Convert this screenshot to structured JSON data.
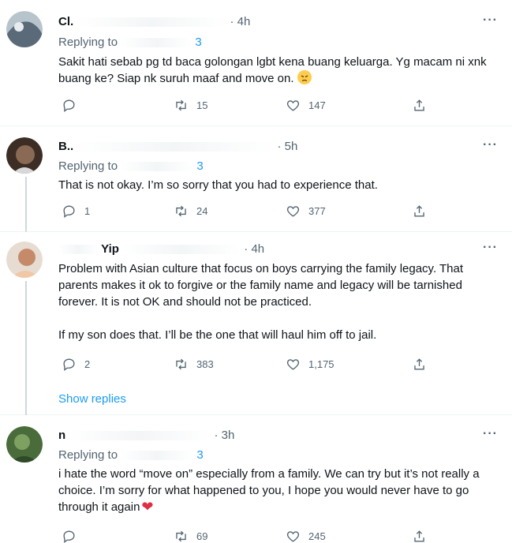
{
  "colors": {
    "accent": "#1d9bf0",
    "secondary_text": "#536471",
    "primary_text": "#0f1419",
    "heart": "#dd2e44"
  },
  "tweets": [
    {
      "name": "Cl.",
      "time": "· 4h",
      "replying_prefix": "Replying to",
      "replying_suffix": "3",
      "text": [
        "Sakit hati sebab pg td baca golongan lgbt kena buang keluarga. Yg macam ni xnk buang ke? Siap nk suruh maaf and move on."
      ],
      "emoji": "angry-face",
      "replies": "",
      "retweets": "15",
      "likes": "147"
    },
    {
      "name": "B..",
      "time": "· 5h",
      "replying_prefix": "Replying to",
      "replying_suffix": "3",
      "text": [
        "That is not okay. I’m so sorry that you had to experience that."
      ],
      "replies": "1",
      "retweets": "24",
      "likes": "377"
    },
    {
      "name": "Yip",
      "time": "· 4h",
      "text": [
        "Problem with Asian culture that focus on boys carrying the family legacy. That parents makes it ok to forgive or the family name and legacy will be tarnished forever. It is not OK and should not be practiced.",
        "If my son does that. I’ll be the one that will haul him off to jail."
      ],
      "replies": "2",
      "retweets": "383",
      "likes": "1,175",
      "show_replies": "Show replies"
    },
    {
      "name": "n",
      "time": "· 3h",
      "replying_prefix": "Replying to",
      "replying_suffix": "3",
      "text": [
        "i hate the word “move on” especially from a family. We can try but it’s not really a choice. I’m sorry for what happened to you, I hope you would never have to go through it again"
      ],
      "emoji": "red-heart",
      "replies": "",
      "retweets": "69",
      "likes": "245"
    }
  ]
}
